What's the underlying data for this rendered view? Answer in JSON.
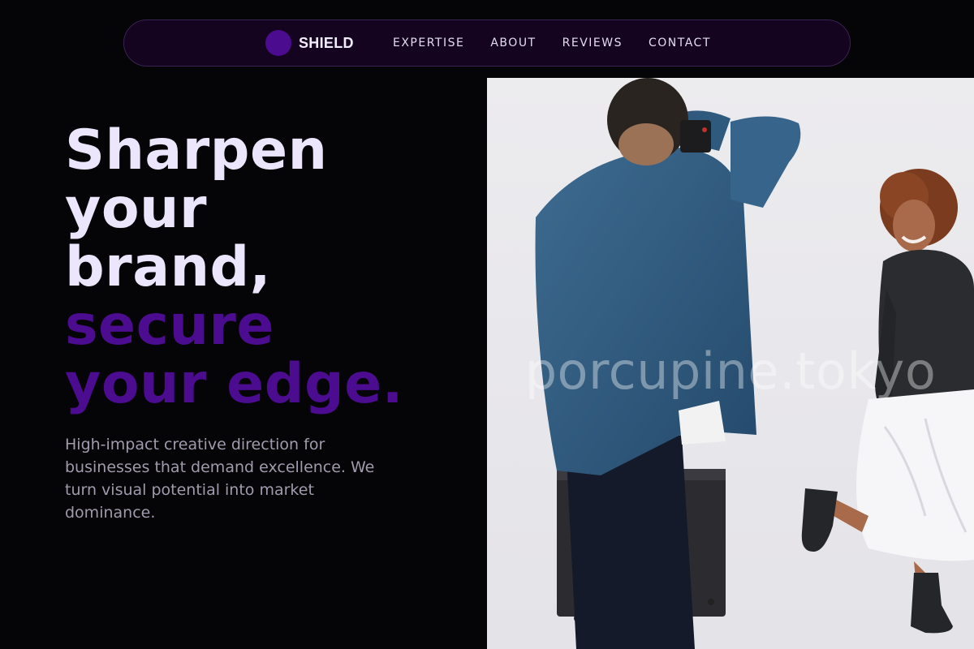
{
  "nav": {
    "brand": "SHIELD",
    "links": [
      "EXPERTISE",
      "ABOUT",
      "REVIEWS",
      "CONTACT"
    ]
  },
  "hero": {
    "headline_lines": [
      "Sharpen",
      "your",
      "brand,"
    ],
    "headline_accent_lines": [
      "secure",
      "your edge."
    ],
    "subcopy": "High-impact creative direction for businesses that demand excellence. We turn visual potential into market dominance."
  },
  "photo": {
    "watermark": "porcupine.tokyo",
    "description_icon": "photographer-and-model-photo"
  },
  "colors": {
    "background": "#050406",
    "accent": "#4b0c8f",
    "headline": "#ebe6fb",
    "subcopy": "#a19bad",
    "nav_bg": "#14041f"
  }
}
